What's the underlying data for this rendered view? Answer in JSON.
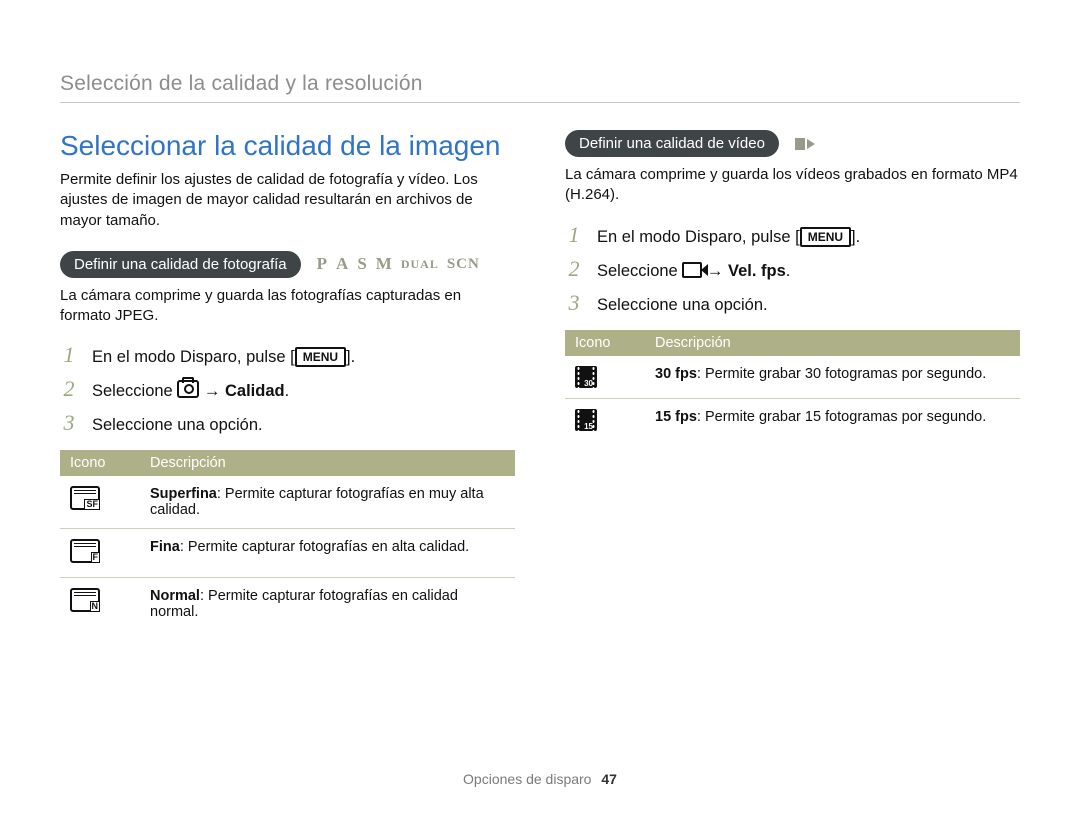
{
  "section_title": "Selección de la calidad y la resolución",
  "h1": "Seleccionar la calidad de la imagen",
  "lead": "Permite definir los ajustes de calidad de fotografía y vídeo. Los ajustes de imagen de mayor calidad resultarán en archivos de mayor tamaño.",
  "photo": {
    "pill": "Definir una calidad de fotografía",
    "modes": {
      "p": "P",
      "a": "A",
      "s": "S",
      "m": "M",
      "dual": "DUAL",
      "scn": "SCN"
    },
    "desc": "La cámara comprime y guarda las fotografías capturadas en formato JPEG.",
    "steps": {
      "s1_pre": "En el modo Disparo, pulse ",
      "menu": "MENU",
      "s1_post": ".",
      "s2_pre": "Seleccione ",
      "s2_arrow": " → ",
      "s2_bold": "Calidad",
      "s2_post": ".",
      "s3": "Seleccione una opción."
    },
    "table": {
      "h_icon": "Icono",
      "h_desc": "Descripción",
      "rows": [
        {
          "tag": "SF",
          "bold": "Superfina",
          "rest": ": Permite capturar fotografías en muy alta calidad."
        },
        {
          "tag": "F",
          "bold": "Fina",
          "rest": ": Permite capturar fotografías en alta calidad."
        },
        {
          "tag": "N",
          "bold": "Normal",
          "rest": ": Permite capturar fotografías en calidad normal."
        }
      ]
    }
  },
  "video": {
    "pill": "Definir una calidad de vídeo",
    "desc": "La cámara comprime y guarda los vídeos grabados en formato MP4 (H.264).",
    "steps": {
      "s1_pre": "En el modo Disparo, pulse ",
      "menu": "MENU",
      "s1_post": ".",
      "s2_pre": "Seleccione ",
      "s2_arrow": " → ",
      "s2_bold": "Vel. fps",
      "s2_post": ".",
      "s3": "Seleccione una opción."
    },
    "table": {
      "h_icon": "Icono",
      "h_desc": "Descripción",
      "rows": [
        {
          "tag": "30",
          "bold": "30 fps",
          "rest": ": Permite grabar 30 fotogramas por segundo."
        },
        {
          "tag": "15",
          "bold": "15 fps",
          "rest": ": Permite grabar 15 fotogramas por segundo."
        }
      ]
    }
  },
  "steps_num": {
    "n1": "1",
    "n2": "2",
    "n3": "3"
  },
  "footer": {
    "label": "Opciones de disparo",
    "page": "47"
  }
}
